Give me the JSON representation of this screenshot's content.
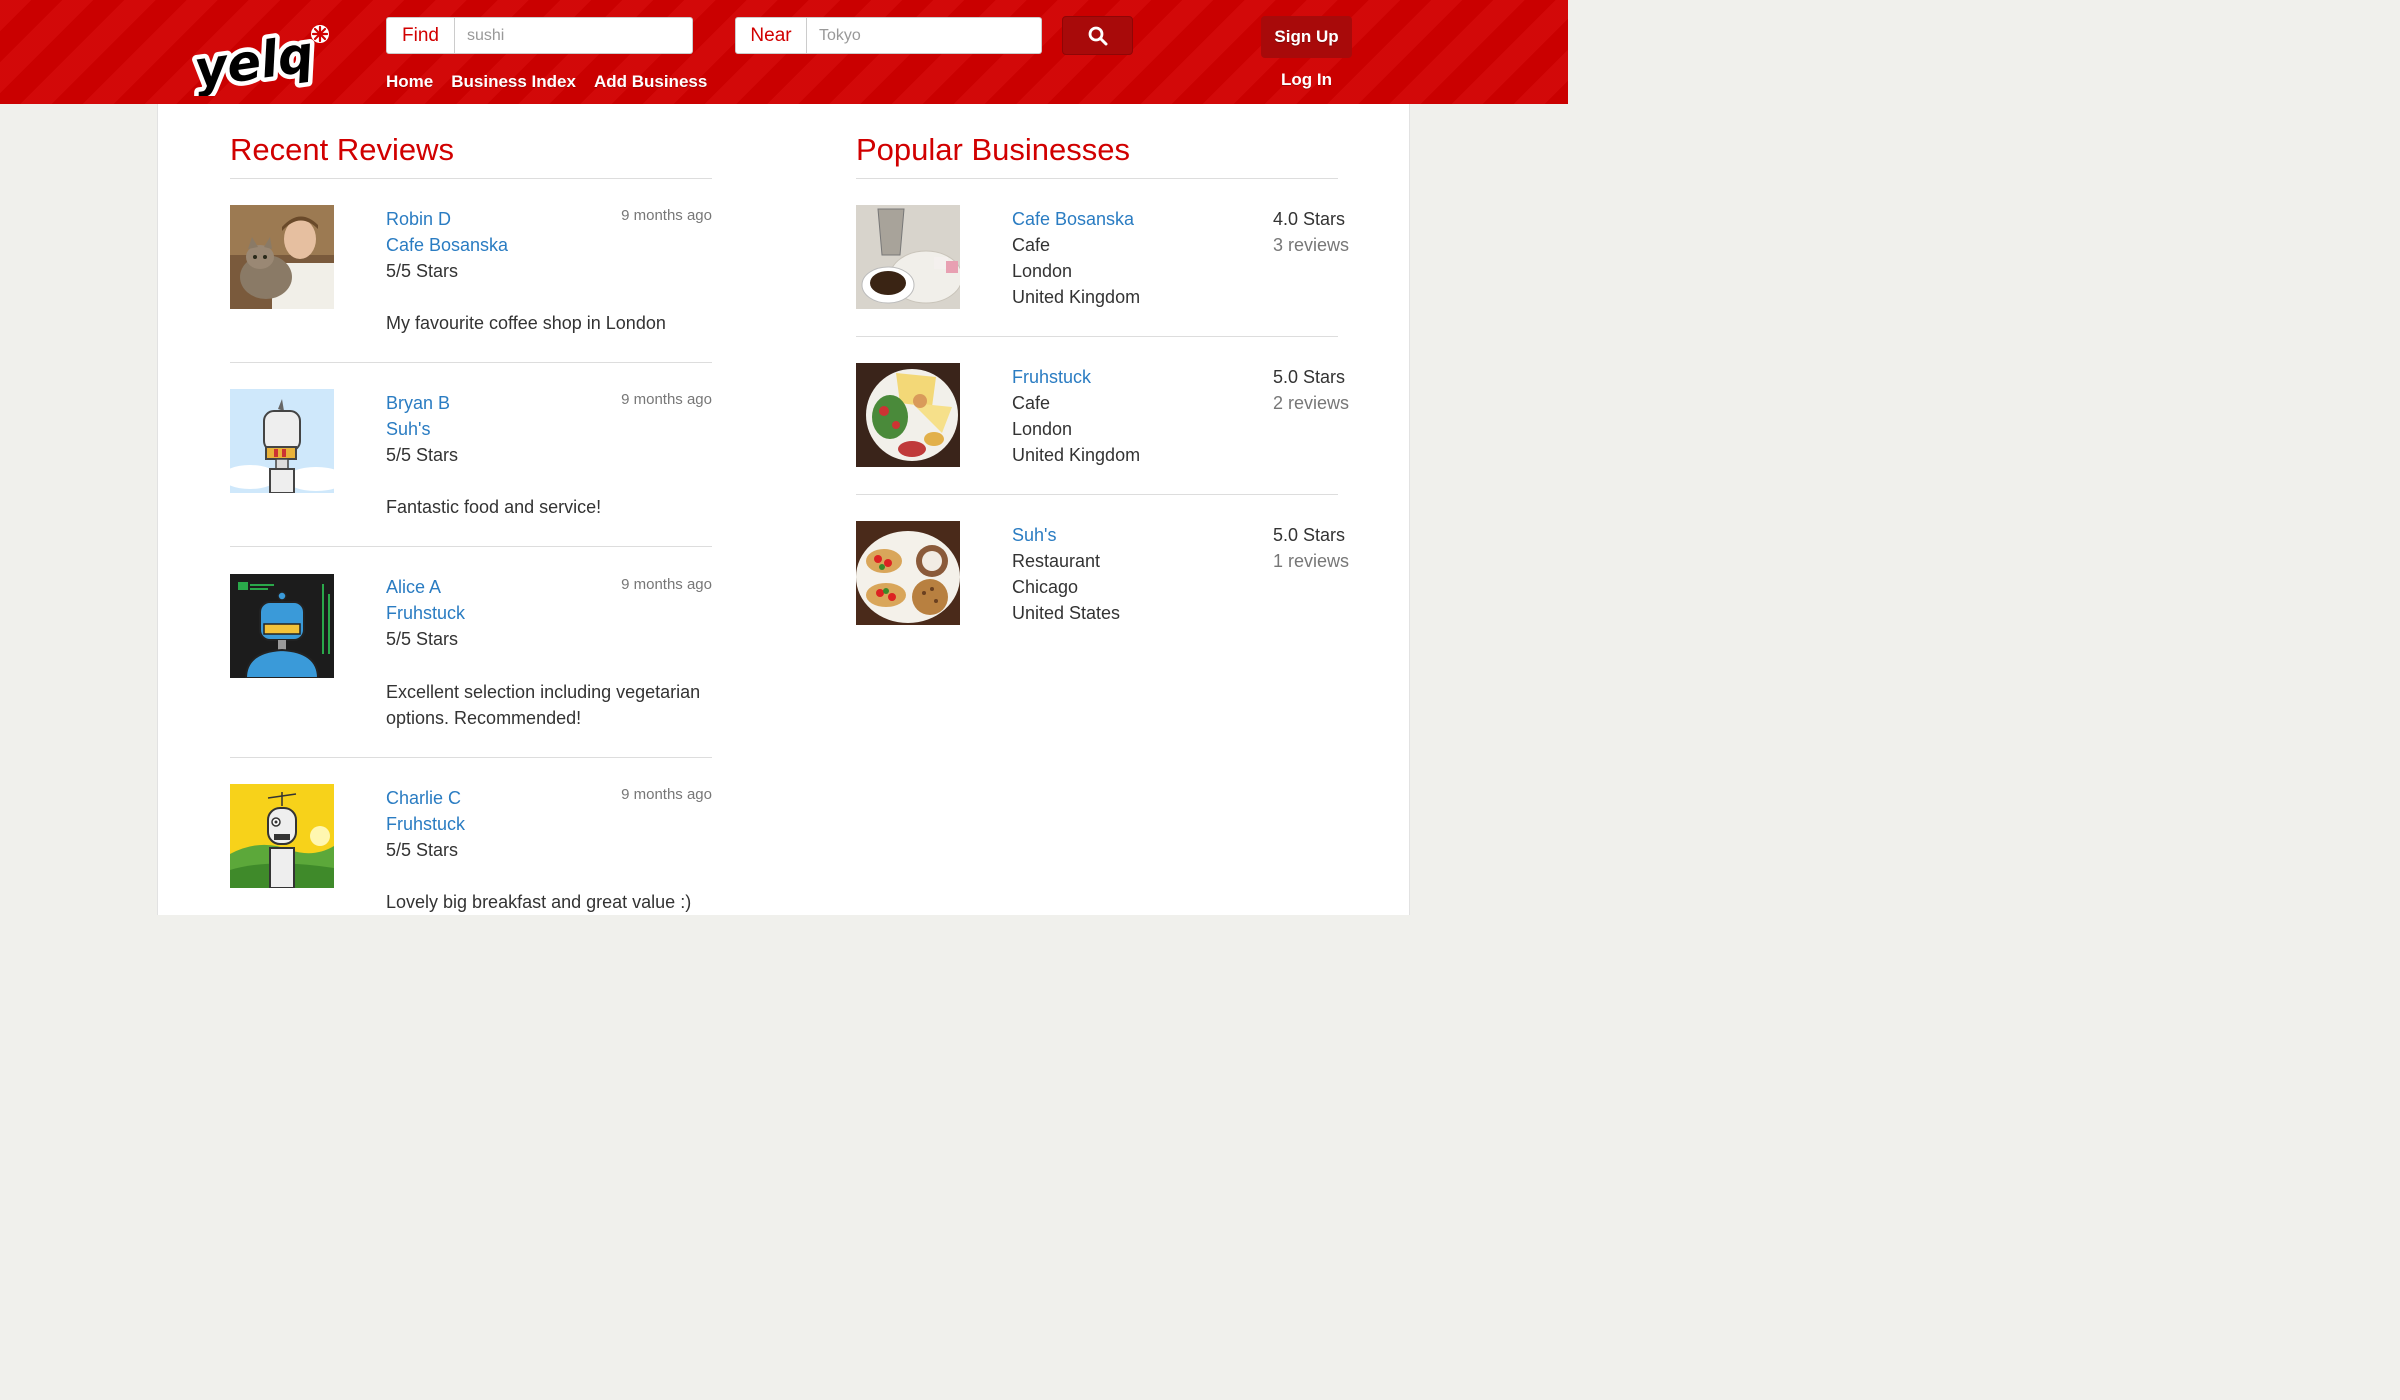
{
  "header": {
    "logo_text": "yelq",
    "find": {
      "label": "Find",
      "placeholder": "sushi"
    },
    "near": {
      "label": "Near",
      "placeholder": "Tokyo"
    },
    "nav": [
      {
        "label": "Home"
      },
      {
        "label": "Business Index"
      },
      {
        "label": "Add Business"
      }
    ],
    "sign_up": "Sign Up",
    "log_in": "Log In"
  },
  "recent_reviews": {
    "title": "Recent Reviews",
    "items": [
      {
        "user": "Robin D",
        "business": "Cafe Bosanska",
        "rating": "5/5 Stars",
        "time": "9 months ago",
        "text": "My favourite coffee shop in London"
      },
      {
        "user": "Bryan B",
        "business": "Suh's",
        "rating": "5/5 Stars",
        "time": "9 months ago",
        "text": "Fantastic food and service!"
      },
      {
        "user": "Alice A",
        "business": "Fruhstuck",
        "rating": "5/5 Stars",
        "time": "9 months ago",
        "text_line1": "Excellent selection including vegetarian",
        "text_line2": "options. Recommended!"
      },
      {
        "user": "Charlie C",
        "business": "Fruhstuck",
        "rating": "5/5 Stars",
        "time": "9 months ago",
        "text": "Lovely big breakfast and great value :)"
      }
    ]
  },
  "popular_businesses": {
    "title": "Popular Businesses",
    "items": [
      {
        "name": "Cafe Bosanska",
        "category": "Cafe",
        "city": "London",
        "country": "United Kingdom",
        "stars": "4.0 Stars",
        "reviews": "3 reviews"
      },
      {
        "name": "Fruhstuck",
        "category": "Cafe",
        "city": "London",
        "country": "United Kingdom",
        "stars": "5.0 Stars",
        "reviews": "2 reviews"
      },
      {
        "name": "Suh's",
        "category": "Restaurant",
        "city": "Chicago",
        "country": "United States",
        "stars": "5.0 Stars",
        "reviews": "1 reviews"
      }
    ]
  },
  "colors": {
    "brand_red": "#d10000",
    "button_dark_red": "#a80a0a",
    "link_blue": "#2a7cc2"
  }
}
